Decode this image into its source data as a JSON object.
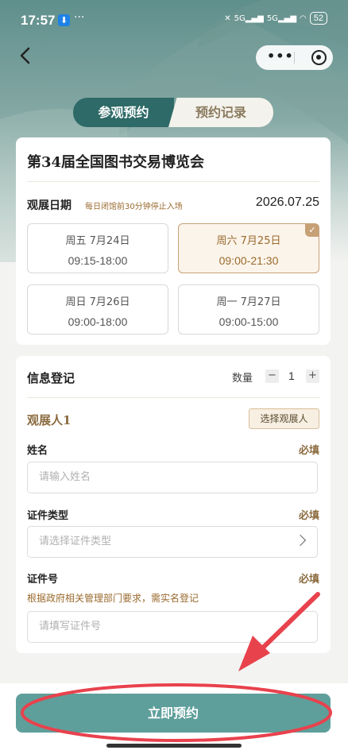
{
  "status": {
    "time": "17:57",
    "more": "···",
    "signal_1": "5G",
    "signal_2": "5G",
    "battery": "52"
  },
  "nav": {
    "more_label": "•••"
  },
  "tabs": [
    {
      "label": "参观预约",
      "active": true
    },
    {
      "label": "预约记录",
      "active": false
    }
  ],
  "event": {
    "title": "第34届全国图书交易博览会"
  },
  "visit_date": {
    "label": "观展日期",
    "note": "每日闭馆前30分钟停止入场",
    "selected": "2026.07.25"
  },
  "days": [
    {
      "date": "周五 7月24日",
      "hours": "09:15-18:00",
      "selected": false
    },
    {
      "date": "周六 7月25日",
      "hours": "09:00-21:30",
      "selected": true
    },
    {
      "date": "周日 7月26日",
      "hours": "09:00-18:00",
      "selected": false
    },
    {
      "date": "周一 7月27日",
      "hours": "09:00-15:00",
      "selected": false
    }
  ],
  "form": {
    "title": "信息登记",
    "qty_label": "数量",
    "qty_minus": "−",
    "qty_value": "1",
    "qty_plus": "+",
    "person_label": "观展人1",
    "choose_button": "选择观展人",
    "name_label": "姓名",
    "name_required": "必填",
    "name_placeholder": "请输入姓名",
    "id_type_label": "证件类型",
    "id_type_required": "必填",
    "id_type_placeholder": "请选择证件类型",
    "id_no_label": "证件号",
    "id_no_required": "必填",
    "id_no_hint": "根据政府相关管理部门要求，需实名登记",
    "id_no_placeholder": "请填写证件号"
  },
  "submit_label": "立即预约",
  "colors": {
    "primary": "#2e6a67",
    "button": "#5f9f9b",
    "accent": "#c7a176",
    "annotation": "#e8424d"
  }
}
